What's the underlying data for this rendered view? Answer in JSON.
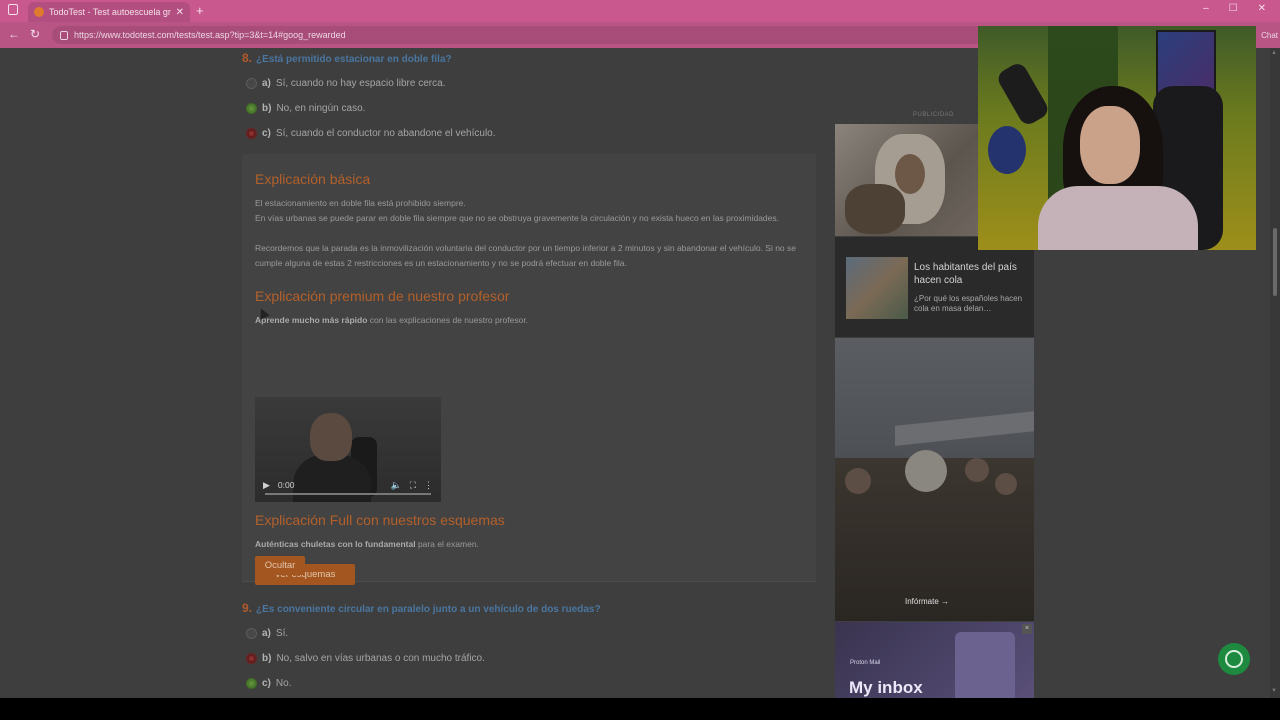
{
  "browser": {
    "tab_title": "TodoTest - Test autoescuela grat…",
    "tab_close": "✕",
    "new_tab": "+",
    "url": "https://www.todotest.com/tests/test.asp?tip=3&t=14#goog_rewarded",
    "chat_label": "Chat",
    "window_controls": [
      "–",
      "☐",
      "✕"
    ]
  },
  "question8": {
    "number": "8.",
    "text": "¿Está permitido estacionar en doble fila?",
    "options": [
      {
        "key": "a)",
        "text": "Sí, cuando no hay espacio libre cerca."
      },
      {
        "key": "b)",
        "text": "No, en ningún caso."
      },
      {
        "key": "c)",
        "text": "Sí, cuando el conductor no abandone el vehículo."
      }
    ]
  },
  "explanation": {
    "basic_title": "Explicación básica",
    "basic_lines": [
      "El estacionamiento en doble fila está prohibido siempre.",
      "En vías urbanas se puede parar en doble fila siempre que no se obstruya gravemente la circulación y no exista hueco en las proximidades.",
      "Recordemos que la parada es la inmovilización voluntaria del conductor por un tiempo inferior a 2 minutos y sin abandonar el vehículo. Si no se cumple alguna de estas 2 restricciones es un estacionamiento y no se podrá efectuar en doble fila."
    ],
    "premium_title": "Explicación premium de nuestro profesor",
    "premium_bold": "Aprende mucho más rápido",
    "premium_rest": " con las explicaciones de nuestro profesor.",
    "video_time": "0:00",
    "full_title": "Explicación Full con nuestros esquemas",
    "full_bold": "Auténticas chuletas con lo fundamental",
    "full_rest": " para el examen.",
    "schemes_button": "Ver esquemas",
    "hide_button": "Ocultar"
  },
  "question9": {
    "number": "9.",
    "text": "¿Es conveniente circular en paralelo junto a un vehículo de dos ruedas?",
    "options": [
      {
        "key": "a)",
        "text": "Sí."
      },
      {
        "key": "b)",
        "text": "No, salvo en vías urbanas o con mucho tráfico."
      },
      {
        "key": "c)",
        "text": "No."
      }
    ]
  },
  "ads": {
    "label": "PUBLICIDAD",
    "ad2_title": "Los habitantes del país hacen cola",
    "ad2_sub": "¿Por qué los españoles hacen cola en masa delan…",
    "ad3_cta": "Infórmate →",
    "ad4_logo": "Proton Mail",
    "ad4_text": "My inbox"
  },
  "colors": {
    "accent_orange": "#b3602a",
    "question_blue": "#4a76a0",
    "correct_green": "#5d8e3a",
    "wrong_red": "#8a2f2f"
  }
}
